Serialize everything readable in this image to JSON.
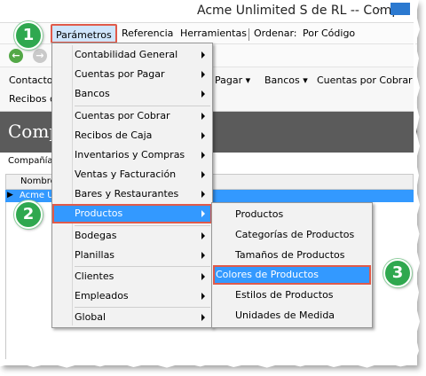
{
  "window": {
    "title": "Acme Unlimited S de RL -- Comp"
  },
  "menubar": {
    "items": [
      "Parámetros",
      "Referencia",
      "Herramientas"
    ],
    "order_label": "Ordenar:",
    "order_value": "Por Código"
  },
  "nav": {
    "back_glyph": "←",
    "forward_glyph": "→"
  },
  "ribbon": {
    "row1": [
      "Contactos",
      "Pagar ▾",
      "Bancos ▾",
      "Cuentas por Cobrar"
    ],
    "row2": [
      "Recibos d"
    ]
  },
  "page": {
    "title": "Comp",
    "company_label": "Compañía",
    "grid_header": "Nombre",
    "row_text": "Acme U"
  },
  "main_menu": {
    "items": [
      {
        "label": "Contabilidad General",
        "submenu": true
      },
      {
        "label": "Cuentas por Pagar",
        "submenu": true
      },
      {
        "label": "Bancos",
        "submenu": true
      },
      {
        "label": "Cuentas por Cobrar",
        "submenu": true
      },
      {
        "label": "Recibos de Caja",
        "submenu": true
      },
      {
        "label": "Inventarios y Compras",
        "submenu": true
      },
      {
        "label": "Ventas y Facturación",
        "submenu": true
      },
      {
        "label": "Bares y Restaurantes",
        "submenu": true
      },
      {
        "label": "Productos",
        "submenu": true,
        "highlighted": true
      },
      {
        "label": "Bodegas",
        "submenu": true
      },
      {
        "label": "Planillas",
        "submenu": true
      },
      {
        "label": "Clientes",
        "submenu": true
      },
      {
        "label": "Empleados",
        "submenu": true
      },
      {
        "label": "Global",
        "submenu": true
      }
    ]
  },
  "sub_menu": {
    "items": [
      {
        "label": "Productos"
      },
      {
        "label": "Categorías de Productos"
      },
      {
        "label": "Tamaños de Productos"
      },
      {
        "label": "Colores de Productos",
        "highlighted": true
      },
      {
        "label": "Estilos de Productos"
      },
      {
        "label": "Unidades de Medida"
      }
    ]
  },
  "steps": [
    "1",
    "2",
    "3"
  ],
  "colors": {
    "highlight": "#3399ff",
    "callout_border": "#e05a4a",
    "badge": "#2fa84f",
    "dark_band": "#5b5b5b"
  }
}
